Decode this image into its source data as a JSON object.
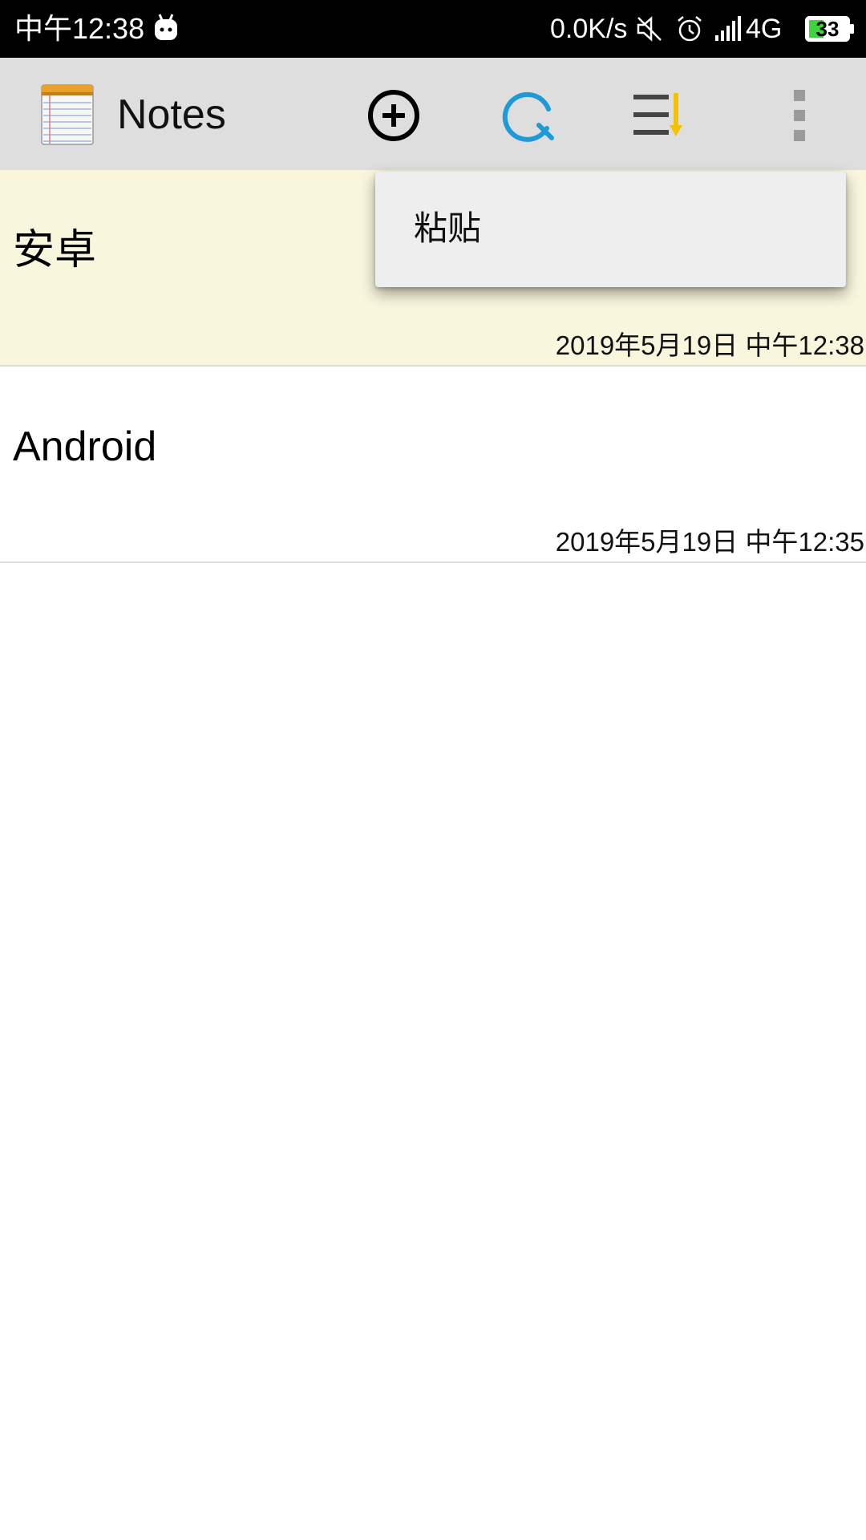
{
  "status_bar": {
    "time": "中午12:38",
    "net_speed": "0.0K/s",
    "network": "4G",
    "battery": "33",
    "icons": [
      "android-icon",
      "mute-icon",
      "alarm-icon",
      "signal-icon",
      "battery-icon"
    ],
    "battery_color": "#3fd33f"
  },
  "action_bar": {
    "title": "Notes",
    "icons": [
      "notepad-app-icon",
      "add-circle-icon",
      "search-icon",
      "sort-icon",
      "overflow-menu-icon"
    ],
    "search_color": "#1e9ad6",
    "sort_accent_color": "#f2c200"
  },
  "notes": [
    {
      "title": "安卓",
      "date": "2019年5月19日 中午12:38",
      "selected": true
    },
    {
      "title": "Android",
      "date": "2019年5月19日 中午12:35",
      "selected": false
    }
  ],
  "popup_menu": {
    "items": [
      {
        "label": "粘贴"
      }
    ]
  },
  "colors": {
    "status_bar_bg": "#000000",
    "action_bar_bg": "#dedede",
    "selected_row_bg": "#f8f6dc",
    "popup_bg": "#eeeeee"
  }
}
